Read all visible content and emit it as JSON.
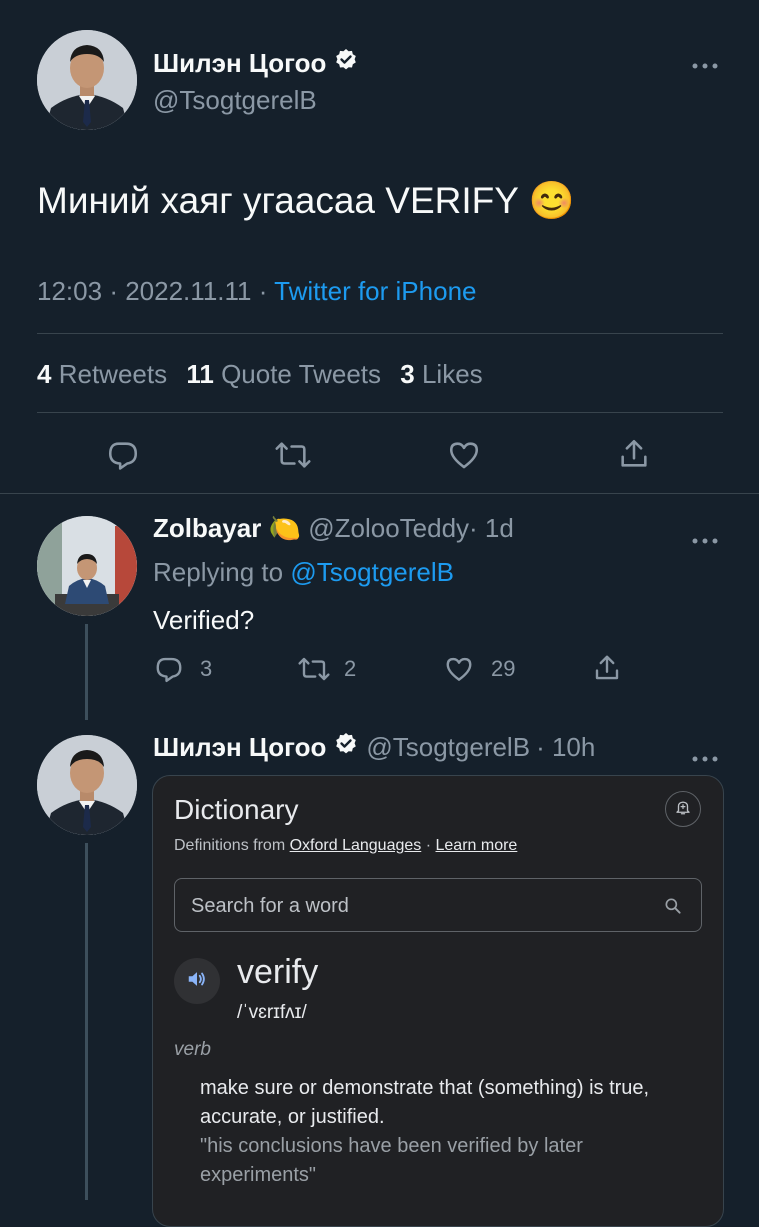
{
  "main_tweet": {
    "author_name": "Шилэн Цогоо",
    "author_handle": "@TsogtgerelB",
    "text": "Миний хаяг угаасаа VERIFY",
    "emoji": "😊",
    "time": "12:03",
    "date": "2022.11.11",
    "sep": "·",
    "source": "Twitter for iPhone",
    "stats": {
      "retweets_count": "4",
      "retweets_label": "Retweets",
      "quotes_count": "11",
      "quotes_label": "Quote Tweets",
      "likes_count": "3",
      "likes_label": "Likes"
    }
  },
  "reply1": {
    "author_name": "Zolbayar",
    "emoji": "🍋",
    "author_handle": "@ZolooTeddy",
    "time": "· 1d",
    "replying_prefix": "Replying to",
    "replying_handle": "@TsogtgerelB",
    "text": "Verified?",
    "replies": "3",
    "retweets": "2",
    "likes": "29"
  },
  "reply2": {
    "author_name": "Шилэн Цогоо",
    "author_handle": "@TsogtgerelB",
    "time": "· 10h"
  },
  "dictionary": {
    "title": "Dictionary",
    "source_prefix": "Definitions from",
    "source_link": "Oxford Languages",
    "sep": "·",
    "learn_more": "Learn more",
    "search_placeholder": "Search for a word",
    "word": "verify",
    "phonetic": "/ˈvɛrɪfʌɪ/",
    "pos": "verb",
    "definition": "make sure or demonstrate that (something) is true, accurate, or justified.",
    "example": "\"his conclusions have been verified by later experiments\""
  },
  "icons": {
    "verified": "verified-badge-icon",
    "more": "more-icon",
    "reply": "reply-icon",
    "retweet": "retweet-icon",
    "like": "heart-icon",
    "share": "share-icon"
  },
  "colors": {
    "background": "#15202b",
    "accent": "#1d9bf0",
    "muted": "#8b98a5",
    "divider": "#38444d"
  }
}
